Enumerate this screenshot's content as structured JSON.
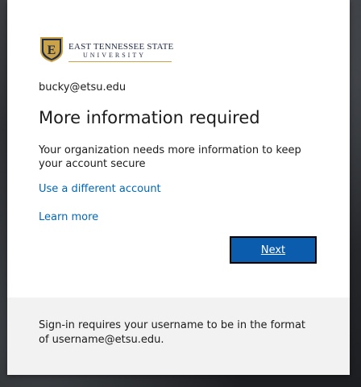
{
  "logo": {
    "line1": "EAST TENNESSEE STATE",
    "line2": "UNIVERSITY",
    "shield_letter": "E",
    "colors": {
      "navy": "#1f2a44",
      "gold": "#c9a24a"
    }
  },
  "account": {
    "email": "bucky@etsu.edu"
  },
  "heading": "More information required",
  "description": "Your organization needs more information to keep your account secure",
  "links": {
    "use_different_account": "Use a different account",
    "learn_more": "Learn more"
  },
  "buttons": {
    "next": "Next"
  },
  "footer": {
    "text": "Sign-in requires your username to be in the format of username@etsu.edu."
  },
  "colors": {
    "link": "#0067b8",
    "button_bg": "#0b5cad",
    "footer_bg": "#f2f2f2"
  }
}
